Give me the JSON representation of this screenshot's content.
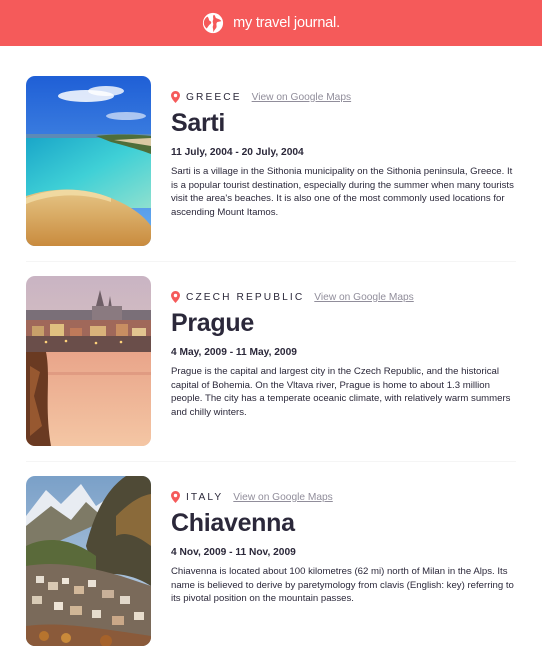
{
  "header": {
    "title": "my travel journal.",
    "icon": "globe-icon",
    "background": "#f55a5a"
  },
  "entries": [
    {
      "country": "GREECE",
      "maps_link": "View on Google Maps",
      "place": "Sarti",
      "dates": "11 July, 2004 - 20 July, 2004",
      "description": "Sarti is a village in the Sithonia municipality on the Sithonia peninsula, Greece. It is a popular tourist destination, especially during the summer when many tourists visit the area's beaches. It is also one of the most commonly used locations for ascending Mount Itamos."
    },
    {
      "country": "CZECH REPUBLIC",
      "maps_link": "View on Google Maps",
      "place": "Prague",
      "dates": "4 May, 2009 - 11 May, 2009",
      "description": "Prague is the capital and largest city in the Czech Republic, and the historical capital of Bohemia. On the Vltava river, Prague is home to about 1.3 million people. The city has a temperate oceanic climate, with relatively warm summers and chilly winters."
    },
    {
      "country": "ITALY",
      "maps_link": "View on Google Maps",
      "place": "Chiavenna",
      "dates": "4 Nov, 2009 - 11 Nov, 2009",
      "description": "Chiavenna is located about 100 kilometres (62 mi) north of Milan in the Alps. Its name is believed to derive by paretymology from clavis (English: key) referring to its pivotal position on the mountain passes."
    }
  ],
  "colors": {
    "accent": "#f55a5a",
    "text": "#2b283a",
    "muted": "#918e9b"
  }
}
